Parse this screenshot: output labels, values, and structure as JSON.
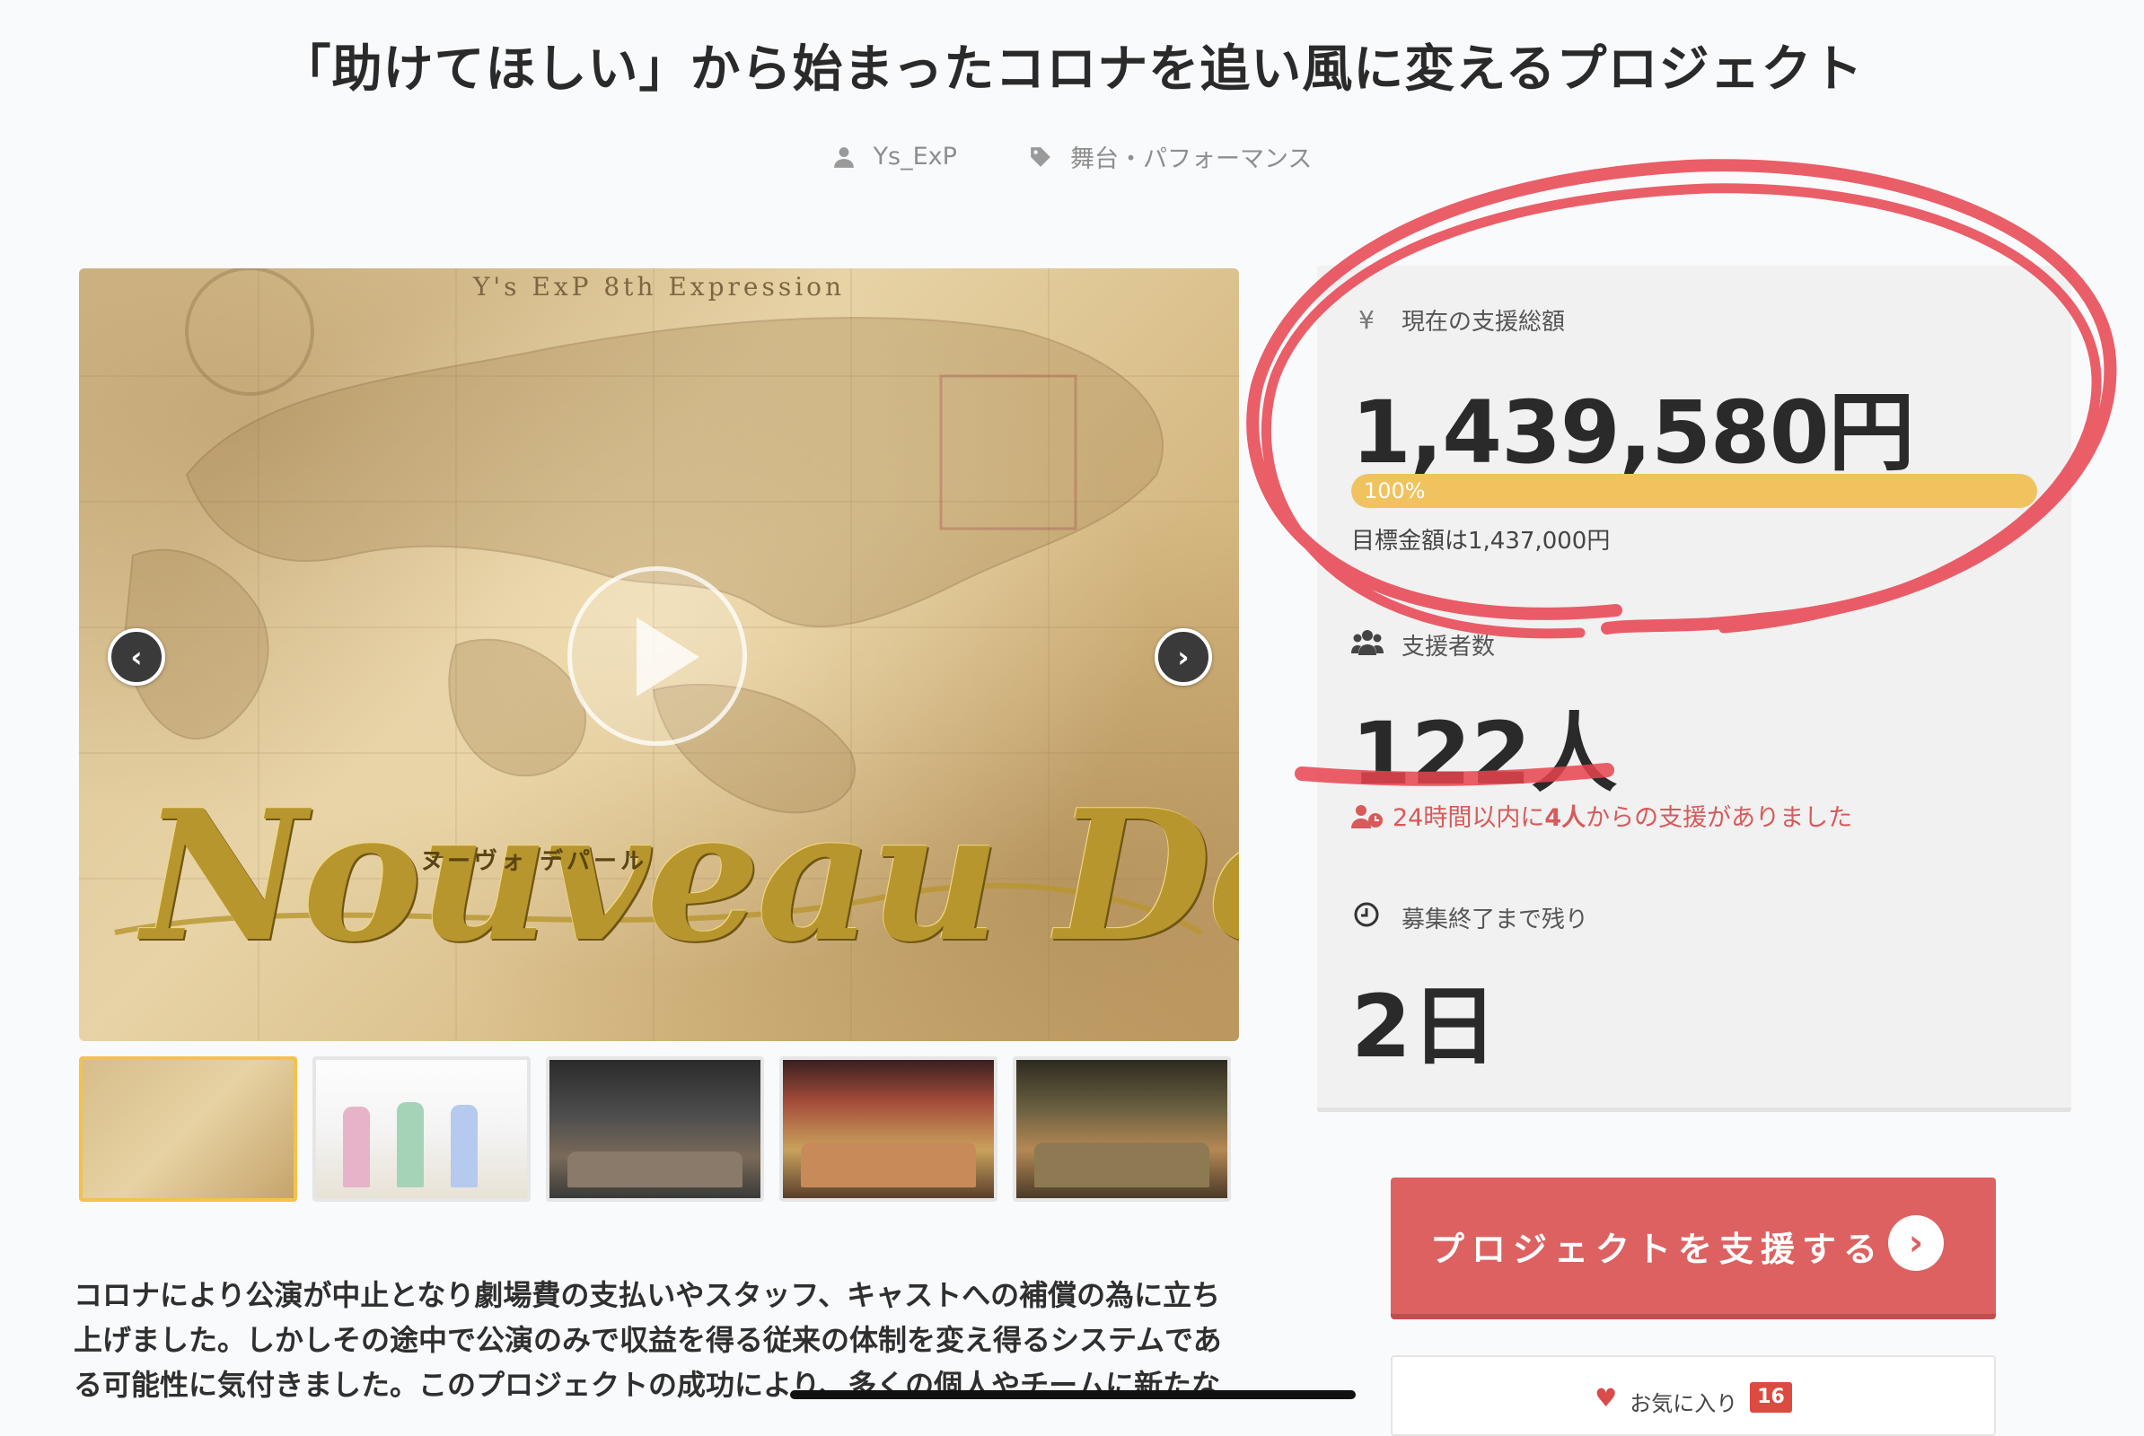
{
  "project": {
    "title": "「助けてほしい」から始まったコロナを追い風に変えるプロジェクト",
    "owner": "Ys_ExP",
    "category": "舞台・パフォーマンス",
    "owner_icon": "user-icon",
    "category_icon": "tag-icon"
  },
  "hero": {
    "header_text": "Y's ExP 8th Expression",
    "logo_text": "Nouveau Départ",
    "logo_subtitle": "ヌーヴォ デパール",
    "prev_label": "‹",
    "next_label": "›"
  },
  "thumbnails": {
    "count": 5,
    "active_index": 0
  },
  "description": "コロナにより公演が中止となり劇場費の支払いやスタッフ、キャストへの補償の為に立ち上げました。しかしその途中で公演のみで収益を得る従来の体制を変え得るシステムである可能性に気付きました。このプロジェクトの成功により、多くの個人やチームに新たな",
  "stats": {
    "amount_label": "現在の支援総額",
    "amount": "1,439,580円",
    "progress_text": "100%",
    "progress_fraction": 1.0,
    "goal_text": "目標金額は1,437,000円",
    "supporters_label": "支援者数",
    "supporters": "122人",
    "recent_prefix": "24時間以内に",
    "recent_count": "4人",
    "recent_suffix": "からの支援がありました",
    "remaining_label": "募集終了まで残り",
    "remaining": "2日"
  },
  "actions": {
    "support_label": "プロジェクトを支援する",
    "favorite_label": "お気に入り",
    "favorite_count": "16"
  },
  "colors": {
    "accent": "#dd6161",
    "progress": "#f0c35e",
    "annotation": "#e8434f"
  }
}
